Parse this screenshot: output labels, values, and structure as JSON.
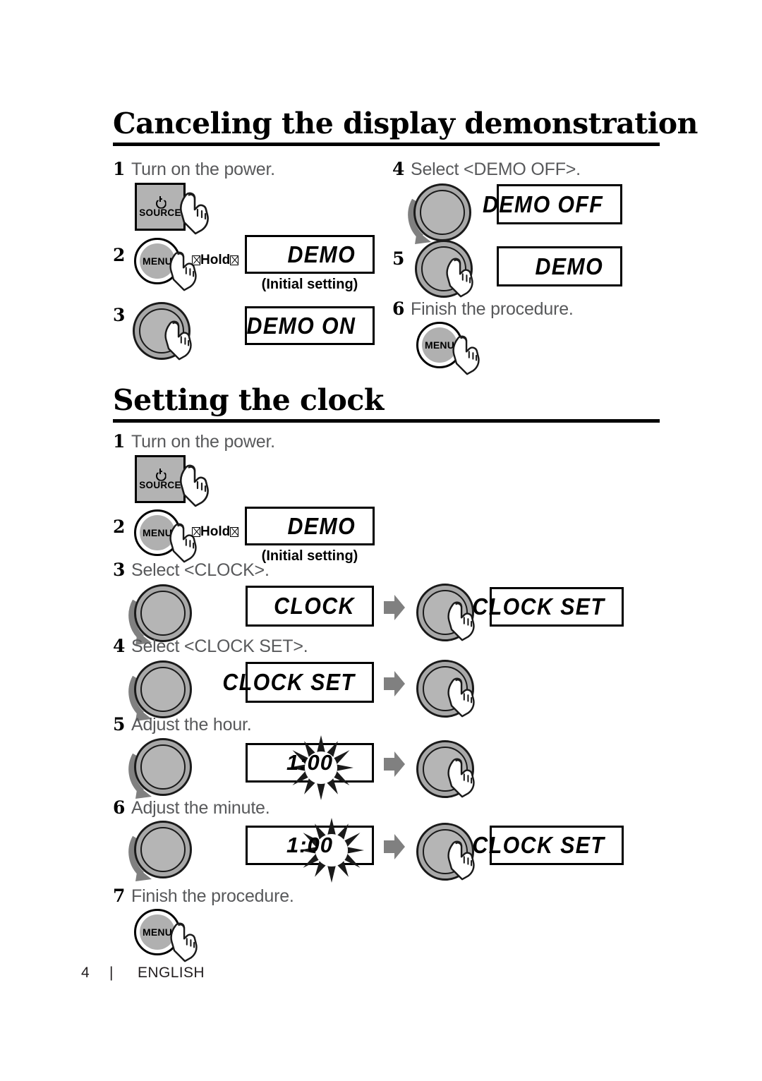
{
  "sections": [
    {
      "title": "Canceling the display demonstration",
      "steps": [
        {
          "num": "1",
          "text": "Turn on the power."
        },
        {
          "num": "2",
          "text": ""
        },
        {
          "num": "3",
          "text": ""
        },
        {
          "num": "4",
          "text": "Select <DEMO OFF>."
        },
        {
          "num": "5",
          "text": ""
        },
        {
          "num": "6",
          "text": "Finish the procedure."
        }
      ],
      "displays": [
        {
          "id": "demo-initial",
          "text": "DEMO",
          "caption": "(Initial setting)"
        },
        {
          "id": "demo-on",
          "text": "DEMO ON"
        },
        {
          "id": "demo-off",
          "text": "DEMO OFF"
        },
        {
          "id": "demo-confirm",
          "text": "DEMO"
        }
      ],
      "hold_label": "Hold"
    },
    {
      "title": "Setting the clock",
      "steps": [
        {
          "num": "1",
          "text": "Turn on the power."
        },
        {
          "num": "2",
          "text": ""
        },
        {
          "num": "3",
          "text": "Select <CLOCK>."
        },
        {
          "num": "4",
          "text": "Select <CLOCK SET>."
        },
        {
          "num": "5",
          "text": "Adjust the hour."
        },
        {
          "num": "6",
          "text": "Adjust the minute."
        },
        {
          "num": "7",
          "text": "Finish the procedure."
        }
      ],
      "displays": [
        {
          "id": "demo-initial-2",
          "text": "DEMO",
          "caption": "(Initial setting)"
        },
        {
          "id": "clock",
          "text": "CLOCK"
        },
        {
          "id": "clock-set-1",
          "text": "CLOCK SET"
        },
        {
          "id": "clock-set-2",
          "text": "CLOCK SET"
        },
        {
          "id": "hour",
          "text": "1:00"
        },
        {
          "id": "minute",
          "text": "1:00"
        },
        {
          "id": "clock-set-3",
          "text": "CLOCK SET"
        }
      ],
      "hold_label": "Hold"
    }
  ],
  "buttons": {
    "source_label": "SOURCE",
    "menu_label": "MENU"
  },
  "footer": {
    "page": "4",
    "separator": "|",
    "language": "ENGLISH"
  },
  "colors": {
    "knob_gray": "#a8a8a8",
    "button_gray": "#b3b3b3",
    "text_gray": "#58595b",
    "black": "#000000",
    "arrow_gray": "#808080"
  }
}
